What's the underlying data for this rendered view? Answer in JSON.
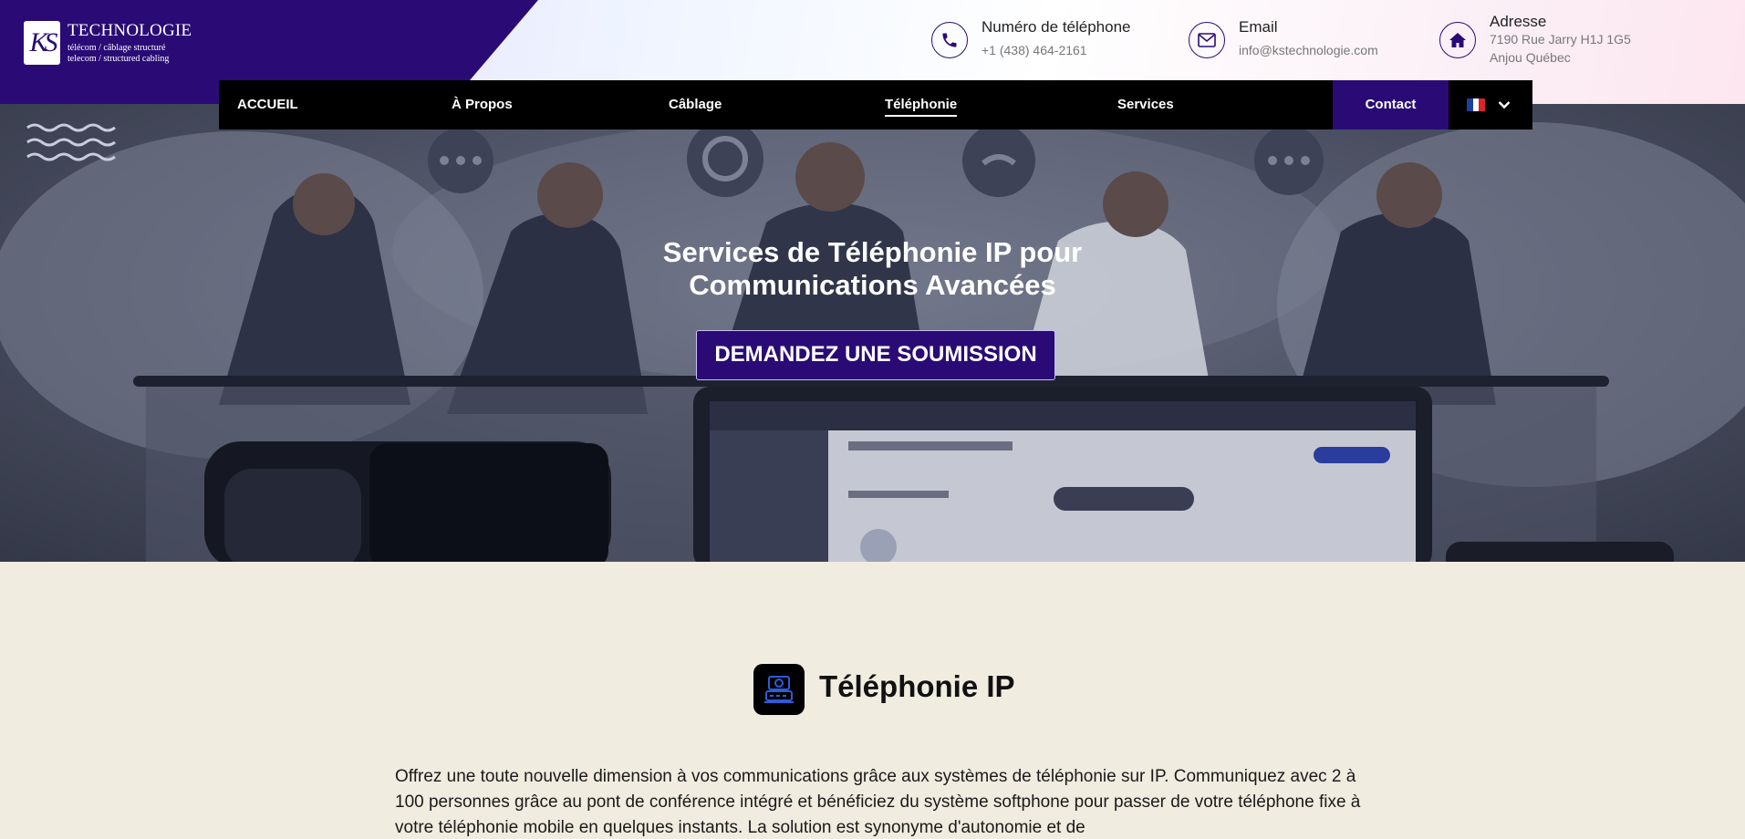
{
  "brand": {
    "monogram": "KS",
    "name": "TECHNOLOGIE",
    "tagline_fr": "télécom / câblage structuré",
    "tagline_en": "telecom / structured cabling"
  },
  "contact": {
    "phone": {
      "label": "Numéro de téléphone",
      "value": "+1 (438) 464-2161",
      "icon": "phone-icon"
    },
    "email": {
      "label": "Email",
      "value": "info@kstechnologie.com",
      "icon": "mail-icon"
    },
    "address": {
      "label": "Adresse",
      "line1": "7190 Rue Jarry H1J 1G5",
      "line2": "Anjou Québec",
      "icon": "home-icon"
    }
  },
  "nav": {
    "items": [
      {
        "label": "ACCUEIL"
      },
      {
        "label": "À Propos"
      },
      {
        "label": "Câblage"
      },
      {
        "label": "Téléphonie",
        "active": true
      },
      {
        "label": "Services"
      }
    ],
    "contact_label": "Contact",
    "language": "FR",
    "language_icon": "flag-fr-icon"
  },
  "hero": {
    "title_line1": "Services de Téléphonie IP pour",
    "title_line2": "Communications Avancées",
    "cta": "DEMANDEZ UNE SOUMISSION"
  },
  "section": {
    "title": "Téléphonie IP",
    "icon": "ip-phone-icon",
    "text": "Offrez une toute nouvelle dimension à vos communications grâce aux systèmes de téléphonie sur IP. Communiquez avec 2 à 100 personnes grâce au pont de conférence intégré et bénéficiez du système softphone pour passer de votre téléphone fixe à votre téléphonie mobile en quelques instants. La solution est synonyme d'autonomie et de"
  },
  "colors": {
    "brand": "#2a0b76",
    "nav_bg": "#000000",
    "page_bg": "#f0ece0"
  }
}
